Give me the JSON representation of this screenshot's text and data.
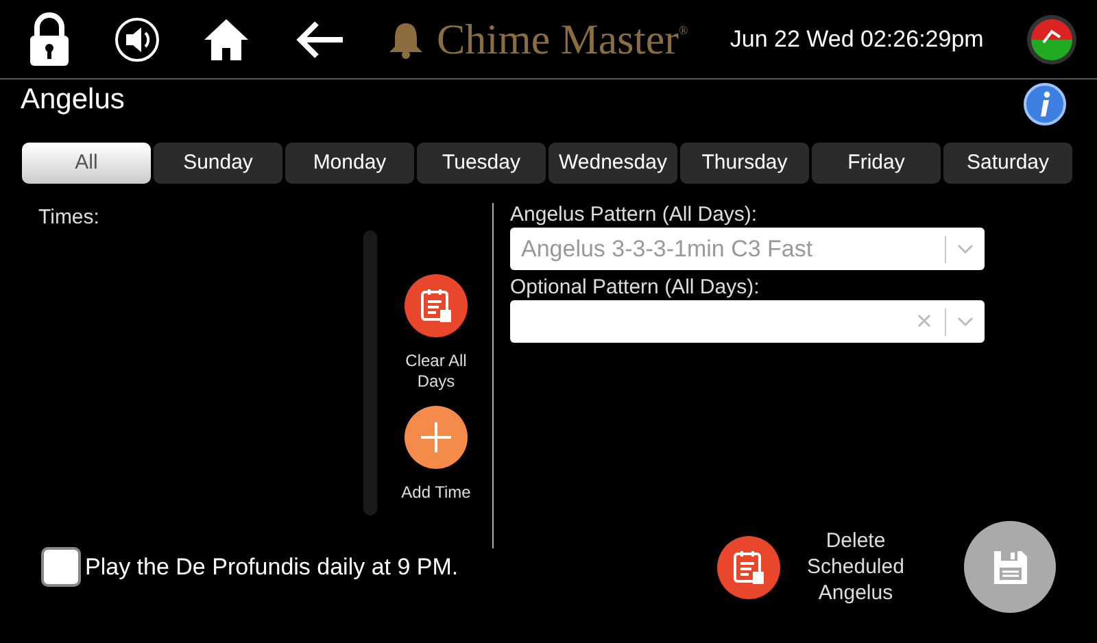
{
  "header": {
    "logo": "Chime Master$^{®}$",
    "datetime": "Jun 22 Wed 02:26:29pm"
  },
  "page_title": "Angelus",
  "tabs": [
    {
      "label": "All",
      "selected": true
    },
    {
      "label": "Sunday",
      "selected": false
    },
    {
      "label": "Monday",
      "selected": false
    },
    {
      "label": "Tuesday",
      "selected": false
    },
    {
      "label": "Wednesday",
      "selected": false
    },
    {
      "label": "Thursday",
      "selected": false
    },
    {
      "label": "Friday",
      "selected": false
    },
    {
      "label": "Saturday",
      "selected": false
    }
  ],
  "times_label": "Times:",
  "clear_button": {
    "label": "Clear All Days"
  },
  "add_button": {
    "label": "Add Time"
  },
  "angelus_pattern": {
    "label": "Angelus Pattern (All Days):",
    "value": "Angelus 3-3-3-1min C3 Fast",
    "disabled": true
  },
  "optional_pattern": {
    "label": "Optional Pattern (All Days):",
    "clearable": true
  },
  "de_profundis": {
    "label": "Play the De Profundis daily at 9 PM.",
    "checked": false
  },
  "delete_button": {
    "label": "Delete Scheduled Angelus"
  }
}
